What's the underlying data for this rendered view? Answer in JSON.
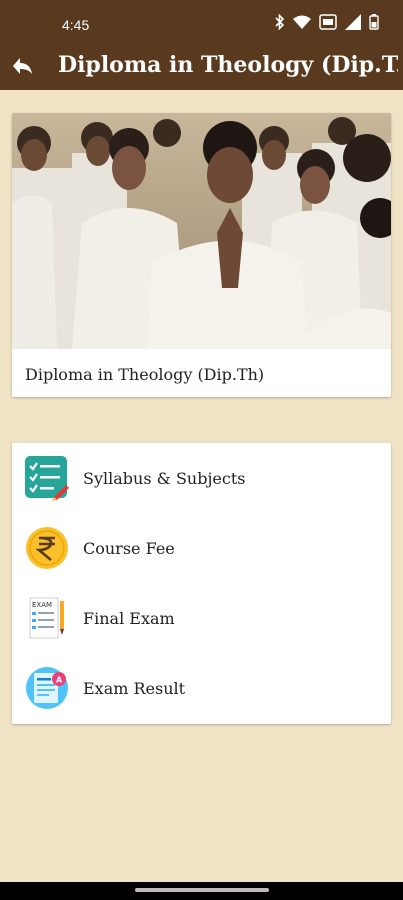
{
  "status_bar": {
    "time": "4:45",
    "icons": [
      "bluetooth-icon",
      "wifi-icon",
      "vowifi-icon",
      "signal-icon",
      "battery-icon"
    ]
  },
  "app_bar": {
    "title": "Diploma in Theology (Dip.T...",
    "back_icon": "back-arrow-icon"
  },
  "hero": {
    "caption": "Diploma in Theology (Dip.Th)"
  },
  "menu": {
    "items": [
      {
        "label": "Syllabus & Subjects",
        "icon": "syllabus-checklist-icon"
      },
      {
        "label": "Course Fee",
        "icon": "rupee-coin-icon"
      },
      {
        "label": "Final Exam",
        "icon": "exam-paper-icon"
      },
      {
        "label": "Exam Result",
        "icon": "exam-result-icon"
      }
    ]
  },
  "colors": {
    "app_bar": "#5a3a1e",
    "background": "#efe2c5",
    "card": "#ffffff"
  }
}
